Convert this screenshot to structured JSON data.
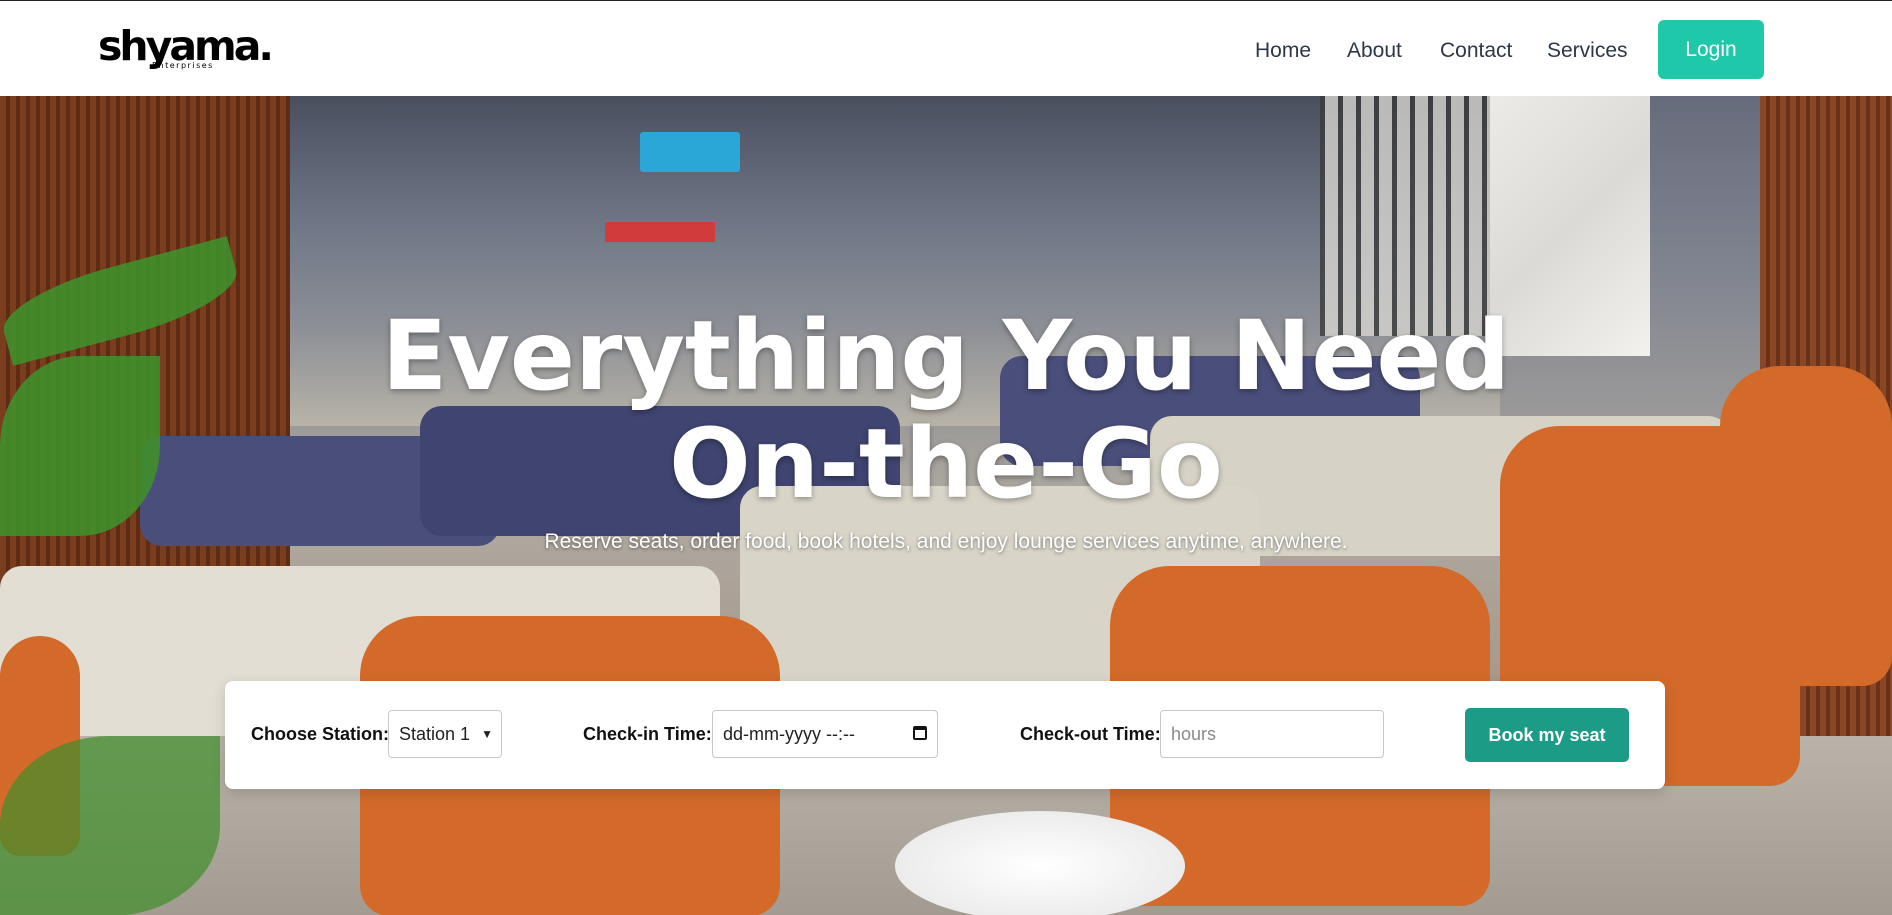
{
  "header": {
    "logo_text": "shyama.",
    "logo_subtext": "Enterprises",
    "nav": [
      "Home",
      "About",
      "Contact",
      "Services"
    ],
    "login_label": "Login"
  },
  "hero": {
    "title": "Everything You Need On-the-Go",
    "subtitle": "Reserve seats, order food, book hotels, and enjoy lounge services anytime, anywhere."
  },
  "booking": {
    "station_label": "Choose Station:",
    "station_value": "Station 1",
    "checkin_label": "Check-in Time:",
    "checkin_value": "dd-mm-yyyy --:--",
    "checkout_label": "Check-out Time:",
    "checkout_placeholder": "hours",
    "book_label": "Book my seat"
  },
  "colors": {
    "login_bg": "#1ec8a8",
    "book_bg": "#1c9b86"
  }
}
